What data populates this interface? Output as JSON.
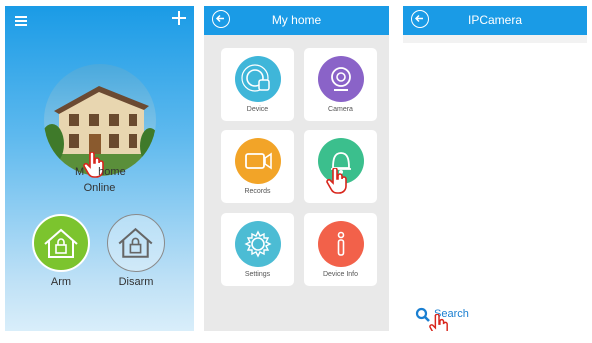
{
  "panel_home": {
    "home_label": "home",
    "home_label_prefix": "M",
    "status": "Online",
    "arm_label": "Arm",
    "disarm_label": "Disarm",
    "colors": {
      "blue": "#1a9be6",
      "green": "#7cc42e"
    }
  },
  "panel_menu": {
    "title": "My home",
    "tiles": [
      {
        "label": "Device",
        "color": "#3fb6d9",
        "icon": "device-icon"
      },
      {
        "label": "Camera",
        "color": "#8a63c8",
        "icon": "camera-icon"
      },
      {
        "label": "Records",
        "color": "#f2a428",
        "icon": "video-icon"
      },
      {
        "label": "",
        "color": "#3bbf8d",
        "icon": "bell-icon"
      },
      {
        "label": "Settings",
        "color": "#4cbcd4",
        "icon": "gear-icon"
      },
      {
        "label": "Device Info",
        "color": "#f2614a",
        "icon": "info-icon"
      }
    ]
  },
  "panel_ipcamera": {
    "title": "IPCamera",
    "search_label": "Search"
  }
}
